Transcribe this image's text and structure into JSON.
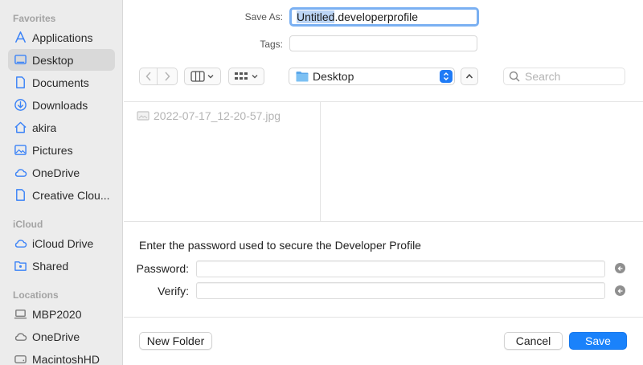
{
  "sidebar": {
    "favorites_title": "Favorites",
    "favorites": [
      {
        "label": "Applications",
        "icon": "applications-icon"
      },
      {
        "label": "Desktop",
        "icon": "desktop-icon",
        "selected": true
      },
      {
        "label": "Documents",
        "icon": "document-icon"
      },
      {
        "label": "Downloads",
        "icon": "download-icon"
      },
      {
        "label": "akira",
        "icon": "home-icon"
      },
      {
        "label": "Pictures",
        "icon": "pictures-icon"
      },
      {
        "label": "OneDrive",
        "icon": "cloud-icon"
      },
      {
        "label": "Creative Clou...",
        "icon": "document-icon"
      }
    ],
    "icloud_title": "iCloud",
    "icloud": [
      {
        "label": "iCloud Drive",
        "icon": "cloud-icon"
      },
      {
        "label": "Shared",
        "icon": "shared-folder-icon"
      }
    ],
    "locations_title": "Locations",
    "locations": [
      {
        "label": "MBP2020",
        "icon": "laptop-icon"
      },
      {
        "label": "OneDrive",
        "icon": "cloud-icon"
      },
      {
        "label": "MacintoshHD",
        "icon": "disk-icon"
      }
    ]
  },
  "save_as": {
    "label": "Save As:",
    "value_selected": "Untitled",
    "value_rest": ".developerprofile"
  },
  "tags": {
    "label": "Tags:",
    "value": ""
  },
  "toolbar": {
    "location": "Desktop",
    "search_placeholder": "Search"
  },
  "browser": {
    "files": [
      {
        "name": "2022-07-17_12-20-57.jpg",
        "icon": "image-file-icon"
      }
    ]
  },
  "password": {
    "title": "Enter the password used to secure the Developer Profile",
    "password_label": "Password:",
    "verify_label": "Verify:"
  },
  "footer": {
    "new_folder": "New Folder",
    "cancel": "Cancel",
    "save": "Save"
  },
  "colors": {
    "accent": "#1a82fb",
    "sidebar_bg": "#ececec",
    "sidebar_icon": "#3a82f7",
    "selection_highlight": "#bcd5f5"
  }
}
